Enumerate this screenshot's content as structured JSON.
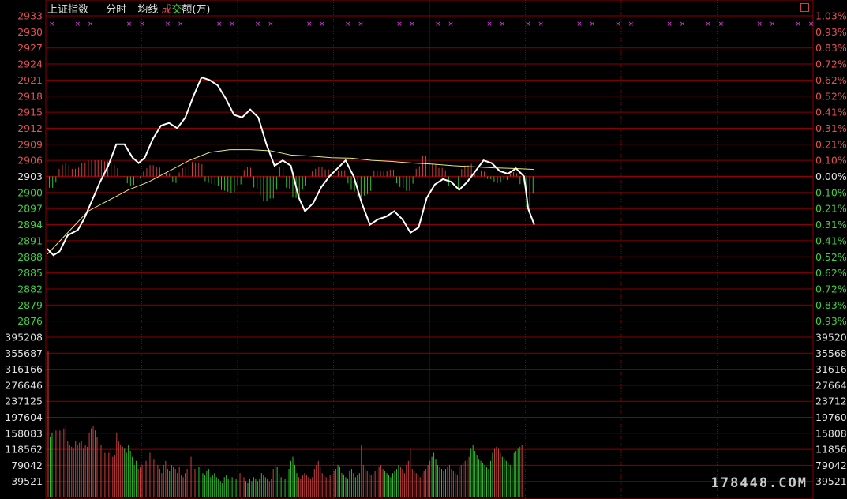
{
  "header": {
    "title": "上证指数",
    "mode": "分时",
    "avg_label": "均线",
    "vol_label_part1": "成",
    "vol_label_part2": "交",
    "vol_label_part3": "额(万)"
  },
  "watermark": "178448.COM",
  "colors": {
    "grid": "#8b0000",
    "axis_up": "#e85050",
    "axis_down": "#40d040",
    "axis_zero": "#e0e0e0",
    "price_line": "#ffffff",
    "avg_line": "#e8e87a",
    "bar_up": "#d04040",
    "bar_down": "#30c030",
    "signal": "#e040e0"
  },
  "chart_data": [
    {
      "type": "line",
      "name": "intraday-price",
      "prev_close": 2903,
      "ylim": [
        2873,
        2933
      ],
      "y_ticks": [
        2933,
        2930,
        2927,
        2924,
        2921,
        2918,
        2915,
        2912,
        2909,
        2906,
        2903,
        2900,
        2897,
        2894,
        2891,
        2888,
        2885,
        2882,
        2879,
        2876
      ],
      "pct_ticks": [
        "1.03%",
        "0.93%",
        "0.83%",
        "0.72%",
        "0.62%",
        "0.52%",
        "0.41%",
        "0.31%",
        "0.21%",
        "0.10%",
        "0.00%",
        "0.10%",
        "0.21%",
        "0.31%",
        "0.41%",
        "0.52%",
        "0.62%",
        "0.72%",
        "0.83%",
        "0.93%"
      ],
      "minutes": 241,
      "price": [
        [
          0,
          2889.5
        ],
        [
          3,
          2888.3
        ],
        [
          6,
          2889
        ],
        [
          10,
          2892
        ],
        [
          15,
          2893
        ],
        [
          18,
          2895
        ],
        [
          22,
          2898.5
        ],
        [
          26,
          2902
        ],
        [
          30,
          2905
        ],
        [
          34,
          2909
        ],
        [
          38,
          2909
        ],
        [
          42,
          2906.5
        ],
        [
          45,
          2905.5
        ],
        [
          48,
          2906.5
        ],
        [
          52,
          2910
        ],
        [
          56,
          2912.5
        ],
        [
          60,
          2913
        ],
        [
          64,
          2912
        ],
        [
          68,
          2914
        ],
        [
          72,
          2918
        ],
        [
          76,
          2921.5
        ],
        [
          80,
          2921
        ],
        [
          84,
          2920
        ],
        [
          88,
          2917.5
        ],
        [
          92,
          2914.5
        ],
        [
          96,
          2914
        ],
        [
          100,
          2915.5
        ],
        [
          104,
          2914
        ],
        [
          108,
          2909
        ],
        [
          112,
          2905
        ],
        [
          116,
          2906
        ],
        [
          120,
          2905
        ],
        [
          124,
          2899
        ],
        [
          127,
          2896.5
        ],
        [
          131,
          2898
        ],
        [
          135,
          2901
        ],
        [
          139,
          2903
        ],
        [
          143,
          2904.5
        ],
        [
          147,
          2906
        ],
        [
          151,
          2903
        ],
        [
          155,
          2898
        ],
        [
          159,
          2894
        ],
        [
          163,
          2895
        ],
        [
          167,
          2895.5
        ],
        [
          171,
          2896.5
        ],
        [
          175,
          2895
        ],
        [
          179,
          2892.5
        ],
        [
          183,
          2893.5
        ],
        [
          187,
          2899
        ],
        [
          191,
          2901.5
        ],
        [
          195,
          2902.5
        ],
        [
          199,
          2902
        ],
        [
          203,
          2900.5
        ],
        [
          207,
          2902
        ],
        [
          211,
          2904
        ],
        [
          215,
          2906
        ],
        [
          219,
          2905.5
        ],
        [
          223,
          2904
        ],
        [
          227,
          2903.5
        ],
        [
          231,
          2904.5
        ],
        [
          235,
          2903
        ],
        [
          237,
          2897
        ],
        [
          240,
          2894
        ]
      ],
      "avg": [
        [
          0,
          2888.5
        ],
        [
          10,
          2892.5
        ],
        [
          20,
          2896.5
        ],
        [
          30,
          2898.5
        ],
        [
          40,
          2900.5
        ],
        [
          50,
          2902
        ],
        [
          60,
          2904
        ],
        [
          70,
          2906
        ],
        [
          80,
          2907.5
        ],
        [
          90,
          2908
        ],
        [
          100,
          2908
        ],
        [
          110,
          2907.8
        ],
        [
          120,
          2907
        ],
        [
          130,
          2906.8
        ],
        [
          140,
          2906.5
        ],
        [
          150,
          2906.4
        ],
        [
          160,
          2906
        ],
        [
          170,
          2905.8
        ],
        [
          180,
          2905.5
        ],
        [
          190,
          2905.3
        ],
        [
          200,
          2905
        ],
        [
          210,
          2904.8
        ],
        [
          220,
          2904.6
        ],
        [
          230,
          2904.5
        ],
        [
          240,
          2904.3
        ]
      ]
    },
    {
      "type": "bar",
      "name": "turnover",
      "ylim": [
        0,
        395208
      ],
      "y_ticks": [
        395208,
        355687,
        316166,
        276646,
        237125,
        197604,
        158083,
        118562,
        79042,
        39521
      ],
      "values": [
        360000,
        150000,
        160000,
        170000,
        165000,
        160000,
        165000,
        160000,
        170000,
        175000,
        140000,
        130000,
        125000,
        120000,
        140000,
        130000,
        135000,
        140000,
        120000,
        130000,
        125000,
        160000,
        170000,
        175000,
        165000,
        150000,
        140000,
        130000,
        120000,
        110000,
        100000,
        110000,
        120000,
        100000,
        105000,
        160000,
        140000,
        130000,
        125000,
        120000,
        110000,
        130000,
        115000,
        100000,
        80000,
        90000,
        70000,
        75000,
        80000,
        85000,
        90000,
        95000,
        110000,
        100000,
        95000,
        90000,
        80000,
        70000,
        60000,
        80000,
        90000,
        70000,
        65000,
        80000,
        75000,
        70000,
        60000,
        75000,
        55000,
        50000,
        60000,
        70000,
        90000,
        100000,
        80000,
        70000,
        60000,
        75000,
        80000,
        60000,
        55000,
        65000,
        70000,
        50000,
        55000,
        60000,
        50000,
        45000,
        40000,
        35000,
        50000,
        55000,
        45000,
        40000,
        50000,
        35000,
        45000,
        55000,
        60000,
        40000,
        50000,
        40000,
        35000,
        45000,
        40000,
        50000,
        45000,
        40000,
        45000,
        60000,
        55000,
        50000,
        45000,
        40000,
        45000,
        70000,
        80000,
        75000,
        60000,
        50000,
        40000,
        45000,
        55000,
        70000,
        90000,
        100000,
        80000,
        60000,
        50000,
        45000,
        55000,
        60000,
        55000,
        50000,
        45000,
        50000,
        70000,
        80000,
        90000,
        75000,
        60000,
        55000,
        50000,
        45000,
        55000,
        60000,
        65000,
        70000,
        80000,
        75000,
        60000,
        55000,
        50000,
        45000,
        65000,
        70000,
        60000,
        50000,
        55000,
        60000,
        130000,
        80000,
        70000,
        65000,
        60000,
        55000,
        60000,
        65000,
        70000,
        75000,
        80000,
        70000,
        65000,
        60000,
        55000,
        50000,
        60000,
        65000,
        70000,
        80000,
        75000,
        70000,
        60000,
        80000,
        90000,
        120000,
        70000,
        65000,
        60000,
        55000,
        50000,
        60000,
        65000,
        70000,
        80000,
        90000,
        100000,
        110000,
        95000,
        80000,
        75000,
        70000,
        65000,
        70000,
        75000,
        80000,
        70000,
        65000,
        60000,
        55000,
        75000,
        80000,
        85000,
        90000,
        95000,
        100000,
        120000,
        130000,
        115000,
        105000,
        95000,
        90000,
        85000,
        80000,
        75000,
        70000,
        90000,
        110000,
        120000,
        125000,
        120000,
        110000,
        100000,
        95000,
        90000,
        85000,
        80000,
        75000,
        110000,
        115000,
        120000,
        125000,
        130000
      ]
    }
  ]
}
